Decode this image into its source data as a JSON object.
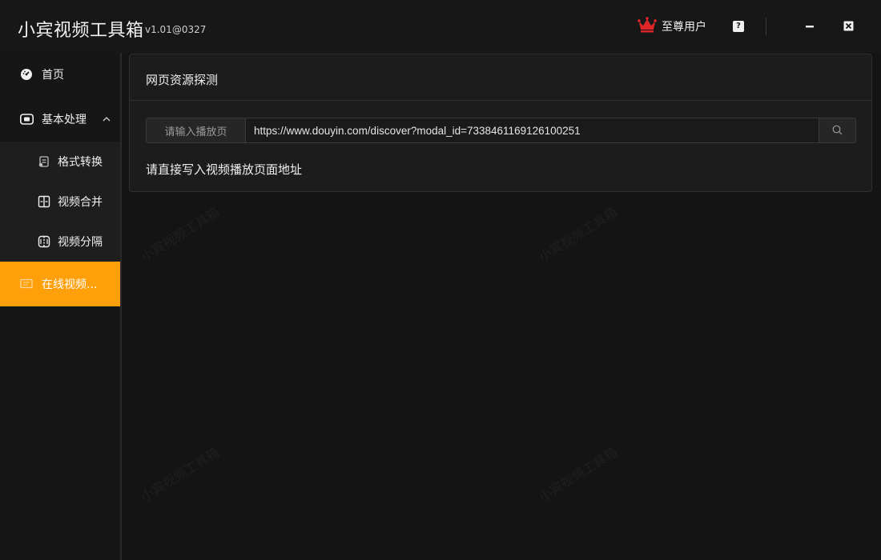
{
  "app": {
    "title": "小宾视频工具箱",
    "version": "v1.01@0327"
  },
  "titlebar": {
    "vip_label": "至尊用户",
    "help_glyph": "?"
  },
  "sidebar": {
    "items": [
      {
        "label": "首页",
        "icon": "dashboard-icon"
      },
      {
        "label": "基本处理",
        "icon": "toolbox-icon",
        "expanded": true
      },
      {
        "label": "格式转换",
        "icon": "format-convert-icon"
      },
      {
        "label": "视频合并",
        "icon": "video-merge-icon"
      },
      {
        "label": "视频分隔",
        "icon": "video-split-icon"
      },
      {
        "label": "在线视频...",
        "icon": "online-video-icon",
        "active": true
      }
    ]
  },
  "panel": {
    "title": "网页资源探测",
    "prefix_label": "请输入播放页",
    "url_value": "https://www.douyin.com/discover?modal_id=7338461169126100251",
    "hint": "请直接写入视频播放页面地址"
  },
  "watermark": "小宾视频工具箱",
  "colors": {
    "accent": "#ff9f0a",
    "vip_crown": "#e0262a",
    "background": "#141414"
  }
}
